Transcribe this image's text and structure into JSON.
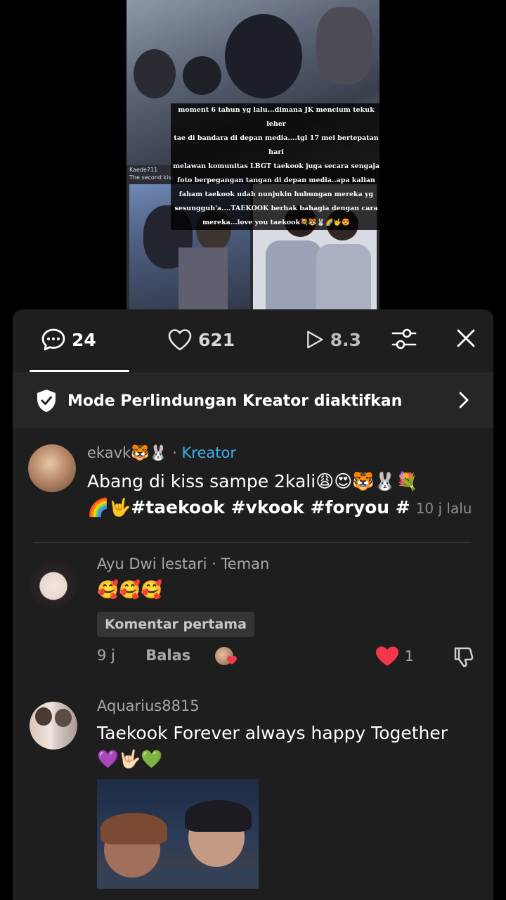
{
  "video": {
    "caption_lines": [
      "moment 6 tahun yg lalu...dimana JK mencium tekuk leher",
      "tae di bandara di depan media....tgl 17 mei bertepatan hari",
      "melawan komunitas LBGT taekook juga secara sengaja",
      "foto berpegangan tangan di depan media..apa kalian",
      "faham  taekook udah nunjukin hubungan mereka yg",
      "sesungguh'a....TAEKOOK berhak bahagia dengan cara",
      "mereka...love you taekook💐🐯🐰🌈🤟😍"
    ],
    "credit_name": "Kaede711",
    "credit_sub": "The second kiss"
  },
  "tabs": {
    "comments_count": "24",
    "likes_count": "621",
    "views_count": "8.3"
  },
  "protection_banner": {
    "text": "Mode Perlindungan Kreator diaktifkan"
  },
  "comments": [
    {
      "username": "ekavk🐯🐰",
      "separator": "·",
      "tag": "Kreator",
      "text": "Abang di kiss sampe 2kali😩😍🐯🐰💐",
      "hashtags": "🌈🤟#taekook #vkook #foryou #",
      "time": "10 j lalu"
    },
    {
      "username": "Ayu Dwi lestari",
      "separator": "·",
      "tag": "Teman",
      "text": "🥰🥰🥰",
      "pill": "Komentar pertama",
      "time": "9 j",
      "reply": "Balas",
      "like_count": "1"
    },
    {
      "username": "Aquarius8815",
      "text_line1": "Taekook Forever always happy Together",
      "text_line2": "💜🤟🏻💚"
    }
  ],
  "colors": {
    "panel_bg": "#1e1e1e",
    "kreator": "#3ab4e8",
    "like_red": "#f2374c"
  }
}
